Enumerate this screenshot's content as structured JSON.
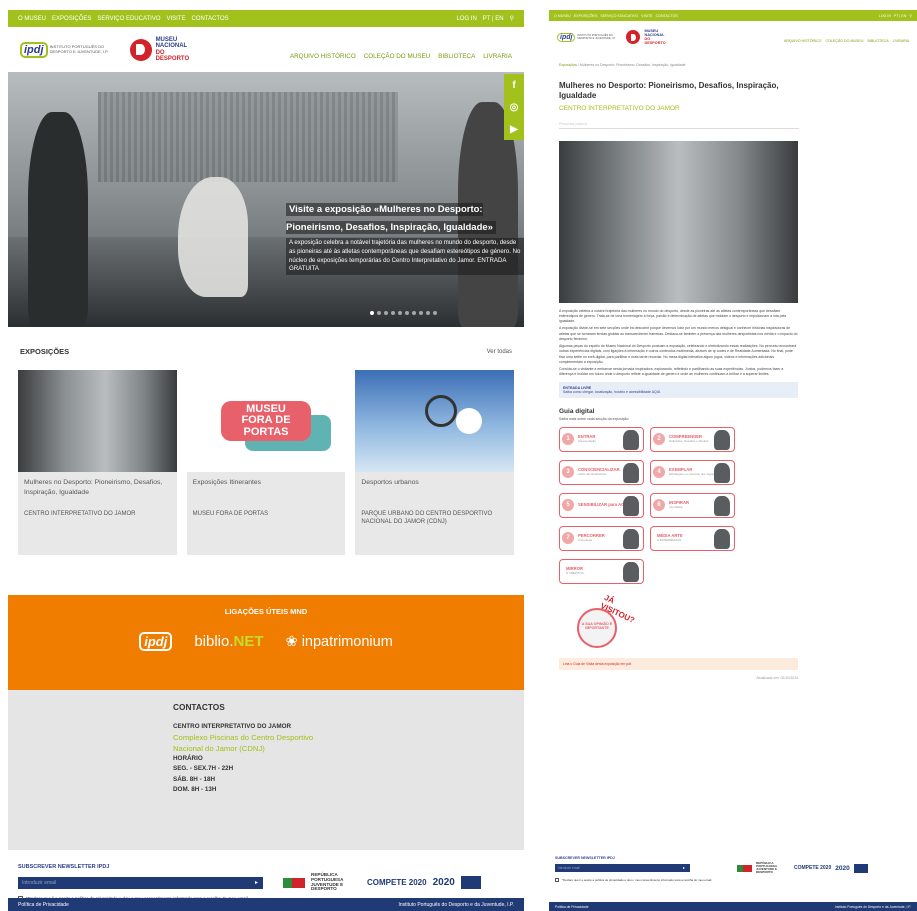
{
  "top_nav": {
    "items": [
      "O MUSEU",
      "EXPOSIÇÕES",
      "SERVIÇO EDUCATIVO",
      "VISITE",
      "CONTACTOS"
    ],
    "login": "LOG IN",
    "lang": "PT | EN",
    "search_icon": "search-icon"
  },
  "header": {
    "ipdj_logo": "ipdj",
    "ipdj_sub": "INSTITUTO PORTUGUÊS DO DESPORTO E JUVENTUDE, I.P.",
    "museum_line1": "MUSEU",
    "museum_line2": "NACIONAL",
    "museum_line3": "DO",
    "museum_line4": "DESPORTO",
    "nav": [
      "ARQUIVO HISTÓRICO",
      "COLEÇÃO DO MUSEU",
      "BIBLIOTECA",
      "LIVRARIA"
    ]
  },
  "hero": {
    "title": "Visite a exposição «Mulheres no Desporto: Pioneirismo, Desafios, Inspiração, Igualdade»",
    "text": "A exposição celebra a notável trajetória das mulheres no mundo do desporto, desde as pioneiras até às atletas contemporâneas que desafiam estereótipos de género. No núcleo de exposições temporárias do Centro Interpretativo do Jamor. ENTRADA GRATUITA",
    "social": [
      "f",
      "◎",
      "▶"
    ]
  },
  "exhibitions": {
    "heading": "EXPOSIÇÕES",
    "see_all": "Ver todas",
    "cards": [
      {
        "title": "Mulheres no Desporto: Pioneirismo, Desafios, Inspiração, Igualdade",
        "location": "CENTRO INTERPRETATIVO DO JAMOR"
      },
      {
        "title": "Exposições Itinerantes",
        "location": "MUSEU FORA DE PORTAS",
        "art": "MUSEU FORA DE PORTAS"
      },
      {
        "title": "Desportos urbanos",
        "location": "PARQUE URBANO DO CENTRO DESPORTIVO NACIONAL DO JAMOR (CDNJ)"
      }
    ]
  },
  "useful_links": {
    "heading": "LIGAÇÕES ÚTEIS MND",
    "ipdj": "ipdj",
    "biblio_a": "biblio.",
    "biblio_b": "NET",
    "inpatrimonium": "❀ inpatrimonium"
  },
  "contacts": {
    "heading": "CONTACTOS",
    "center": "CENTRO INTERPRETATIVO DO JAMOR",
    "address": "Complexo Piscinas do Centro Desportivo Nacional do Jamor (CDNJ)",
    "hours_label": "HORÁRIO",
    "hours": [
      "SEG. - SEX.7H - 22H",
      "SÁB. 8H - 18H",
      "DOM. 8H - 13H"
    ]
  },
  "newsletter": {
    "label": "SUBSCREVER NEWSLETTER IPDJ",
    "placeholder": "Introduzir email",
    "consent": "*Declaro que li e aceito a política de privacidade e dou o meu consentimento informado para a recolha do meu email.",
    "flag_text": "REPÚBLICA PORTUGUESA JUVENTUDE E DESPORTO",
    "compete": "COMPETE 2020",
    "portugal2020": "2020"
  },
  "footer": {
    "privacy": "Política de Privacidade",
    "org": "Instituto Português do Desporto e da Juventude, I.P."
  },
  "detail": {
    "breadcrumb_a": "Exposições",
    "breadcrumb_b": "Mulheres no Desporto: Pioneirismo, Desafios, Inspiração, Igualdade",
    "title": "Mulheres no Desporto: Pioneirismo, Desafios, Inspiração, Igualdade",
    "subtitle": "CENTRO INTERPRETATIVO DO JAMOR",
    "search_placeholder": "Pesquisar palavra",
    "paragraphs": [
      "A exposição celebra a notável trajetória das mulheres no mundo do desporto, desde as pioneiras até às atletas contemporâneas que desafiam estereótipos de género. Trata-se de uma homenagem à força, paixão e determinação de atletas que moldam o desporto e impulsionam a luta pela igualdade.",
      "A exposição divide-se em sete secções onde irá descobrir porque devemos lutar por um mundo menos desigual e conhecer histórias inspiradoras de atletas que se tornaram lendas globais ao transcenderem barreiras. Destaca-se também a presença das mulheres desportistas nos média e o impacto do desporto feminino.",
      "Algumas peças do espólio do Museu Nacional do Desporto pontuam a exposição, celebrando e simbolizando essas realizações. No percurso encontrará outras experiências digitais, com ligações à informação e outros conteúdos multimédia, através de qr codes e de Realidade Aumentada. No final, pode tirar uma selfie no ecrã digital, para partilhar e mais tarde recordar. No mesa digital interativa algum jogos, videos e informações adicionais complementam a exposição.",
      "Convida-se o visitante a embarcar nesta jornada inspiradora, explorando, refletindo e partilhando as suas experiências. Juntos, podemos fazer a diferença e moldar um futuro onde o desporto reflete a igualdade de género e onde as mulheres continuam a brilhar e a superar limites."
    ],
    "entry_title": "ENTRADA LIVRE",
    "entry_text": "Saiba como chegar, localização, horário e acessibilidade AQUI.",
    "guide_title": "Guia digital",
    "guide_sub": "Saiba mais sobre cada secção da exposição:",
    "guide_tiles": [
      {
        "n": "1",
        "label": "ENTRAR",
        "sub": "Apresentação"
      },
      {
        "n": "2",
        "label": "COMPREENDER",
        "sub": "Definições, Desafios e Direitos"
      },
      {
        "n": "3",
        "label": "CONSCIENCIALIZAR",
        "sub": "sobre das Estatísticas"
      },
      {
        "n": "4",
        "label": "EXEMPLAR",
        "sub": "Estratégias e o exemplo dos Jogos Olímpicos"
      },
      {
        "n": "5",
        "label": "SENSIBILIZAR para AGIR",
        "sub": ""
      },
      {
        "n": "6",
        "label": "INSPIRAR",
        "sub": "nos Média"
      },
      {
        "n": "7",
        "label": "PERCORRER",
        "sub": "Cronologia"
      },
      {
        "n": "",
        "label": "MÉDIA ARTE",
        "sub": "& EXPERIÊNCIAS"
      },
      {
        "n": "",
        "label": "MIRROR",
        "sub": "& CRÉDITOS"
      }
    ],
    "visited_text": "A SUA OPINIÃO É IMPORTANTE",
    "visited_badge": "JÁ VISITOU?",
    "note": "Leia o Guia de Visita desta exposição em pdf.",
    "updated": "Atualizado em: 02/10/2024"
  },
  "colors": {
    "green": "#a2c11c",
    "orange": "#f07d00",
    "navy": "#1f3a74",
    "red": "#d2232a",
    "pink": "#e8606a"
  }
}
